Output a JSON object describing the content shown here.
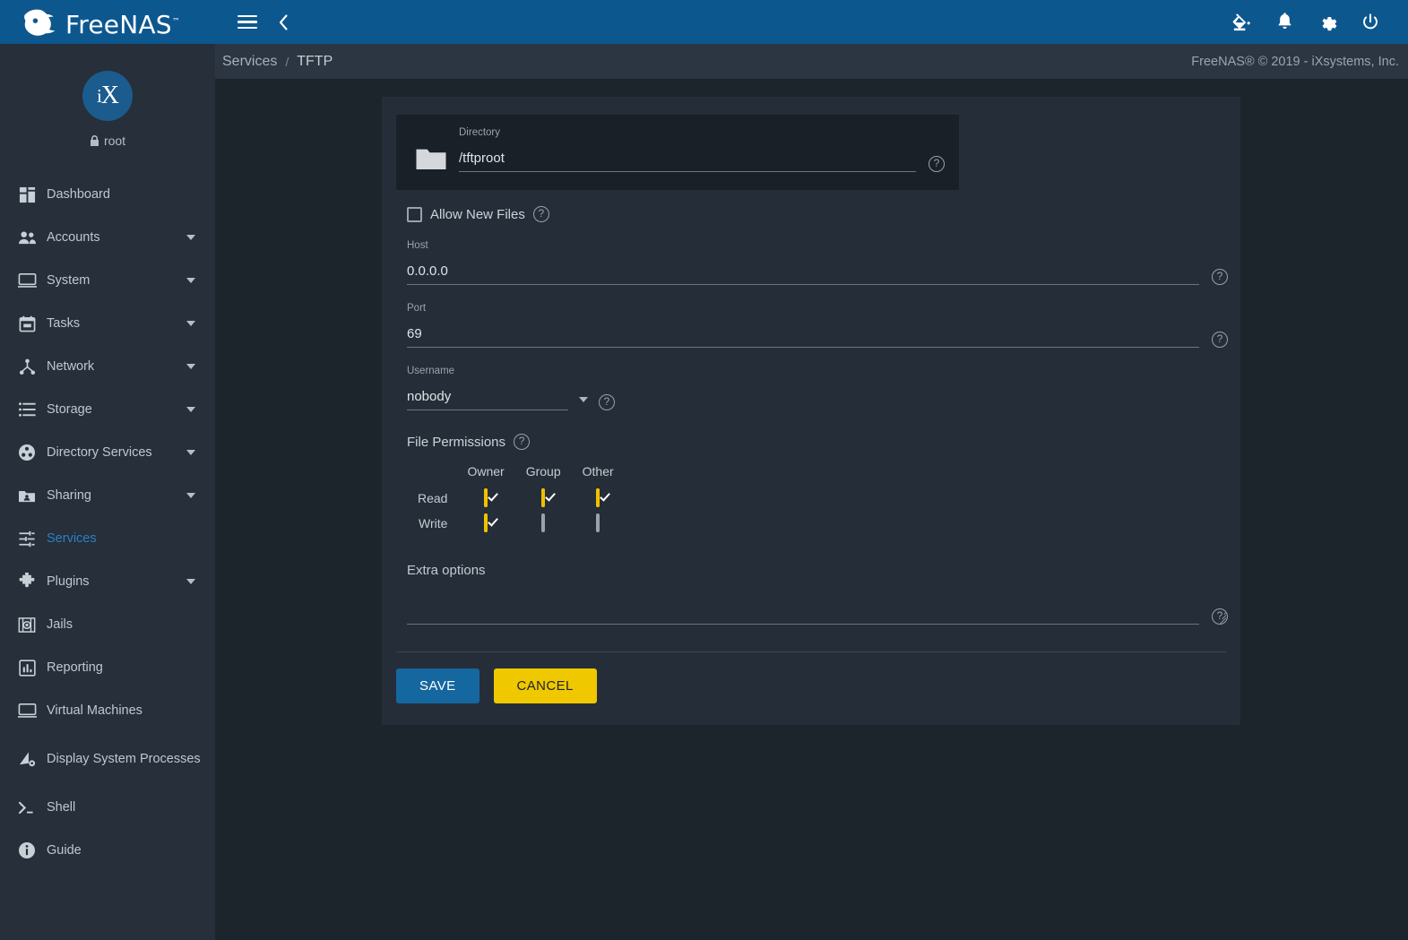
{
  "brand": {
    "name": "FreeNAS",
    "trademark": "™"
  },
  "topbar": {
    "menu_icon": "hamburger-icon",
    "back_icon": "chevron-left-icon",
    "actions": [
      {
        "icon": "paint-bucket-icon",
        "name": "theme-toggle"
      },
      {
        "icon": "bell-icon",
        "name": "notifications"
      },
      {
        "icon": "gear-icon",
        "name": "settings"
      },
      {
        "icon": "power-icon",
        "name": "power"
      }
    ]
  },
  "breadcrumb": {
    "root": "Services",
    "separator": "/",
    "current": "TFTP"
  },
  "copyright": "FreeNAS® © 2019 - iXsystems, Inc.",
  "profile": {
    "initials": "iX",
    "username": "root",
    "lock_icon": "lock-icon"
  },
  "sidebar": {
    "items": [
      {
        "label": "Dashboard",
        "icon": "dashboard-icon",
        "expandable": false,
        "active": false
      },
      {
        "label": "Accounts",
        "icon": "people-icon",
        "expandable": true,
        "active": false
      },
      {
        "label": "System",
        "icon": "monitor-icon",
        "expandable": true,
        "active": false
      },
      {
        "label": "Tasks",
        "icon": "calendar-icon",
        "expandable": true,
        "active": false
      },
      {
        "label": "Network",
        "icon": "network-icon",
        "expandable": true,
        "active": false
      },
      {
        "label": "Storage",
        "icon": "storage-icon",
        "expandable": true,
        "active": false
      },
      {
        "label": "Directory Services",
        "icon": "directory-services-icon",
        "expandable": true,
        "active": false
      },
      {
        "label": "Sharing",
        "icon": "sharing-folder-icon",
        "expandable": true,
        "active": false
      },
      {
        "label": "Services",
        "icon": "sliders-icon",
        "expandable": false,
        "active": true
      },
      {
        "label": "Plugins",
        "icon": "puzzle-icon",
        "expandable": true,
        "active": false
      },
      {
        "label": "Jails",
        "icon": "jails-icon",
        "expandable": false,
        "active": false
      },
      {
        "label": "Reporting",
        "icon": "bar-chart-icon",
        "expandable": false,
        "active": false
      },
      {
        "label": "Virtual Machines",
        "icon": "monitor-icon",
        "expandable": false,
        "active": false
      },
      {
        "label": "Display System Processes",
        "icon": "processes-icon",
        "expandable": false,
        "active": false
      },
      {
        "label": "Shell",
        "icon": "terminal-icon",
        "expandable": false,
        "active": false
      },
      {
        "label": "Guide",
        "icon": "info-icon",
        "expandable": false,
        "active": false
      }
    ]
  },
  "form": {
    "directory": {
      "label": "Directory",
      "value": "/tftproot",
      "placeholder": "",
      "icon": "folder-icon",
      "help": "?"
    },
    "allow_new_files": {
      "label": "Allow New Files",
      "checked": false,
      "help": "?"
    },
    "host": {
      "label": "Host",
      "value": "0.0.0.0",
      "placeholder": "",
      "help": "?"
    },
    "port": {
      "label": "Port",
      "value": "69",
      "placeholder": "",
      "help": "?"
    },
    "username": {
      "label": "Username",
      "value": "nobody",
      "help": "?",
      "caret": "chevron-down-icon"
    },
    "file_permissions": {
      "label": "File Permissions",
      "help": "?",
      "columns": [
        "Owner",
        "Group",
        "Other"
      ],
      "rows": [
        {
          "label": "Read",
          "values": [
            true,
            true,
            true
          ]
        },
        {
          "label": "Write",
          "values": [
            true,
            false,
            false
          ]
        }
      ]
    },
    "extra_options": {
      "label": "Extra options",
      "value": "",
      "placeholder": "",
      "help": "?"
    },
    "buttons": {
      "save": "SAVE",
      "cancel": "CANCEL"
    }
  },
  "colors": {
    "header_blue": "#0d578f",
    "accent_blue": "#2b80c4",
    "save_blue": "#15679f",
    "cancel_yellow": "#f0c800",
    "checkbox_yellow": "#f0c000",
    "sidebar_bg": "#262f3a",
    "page_bg": "#1c242c",
    "card_bg": "#252e38",
    "panel_bg": "#1a2027"
  }
}
